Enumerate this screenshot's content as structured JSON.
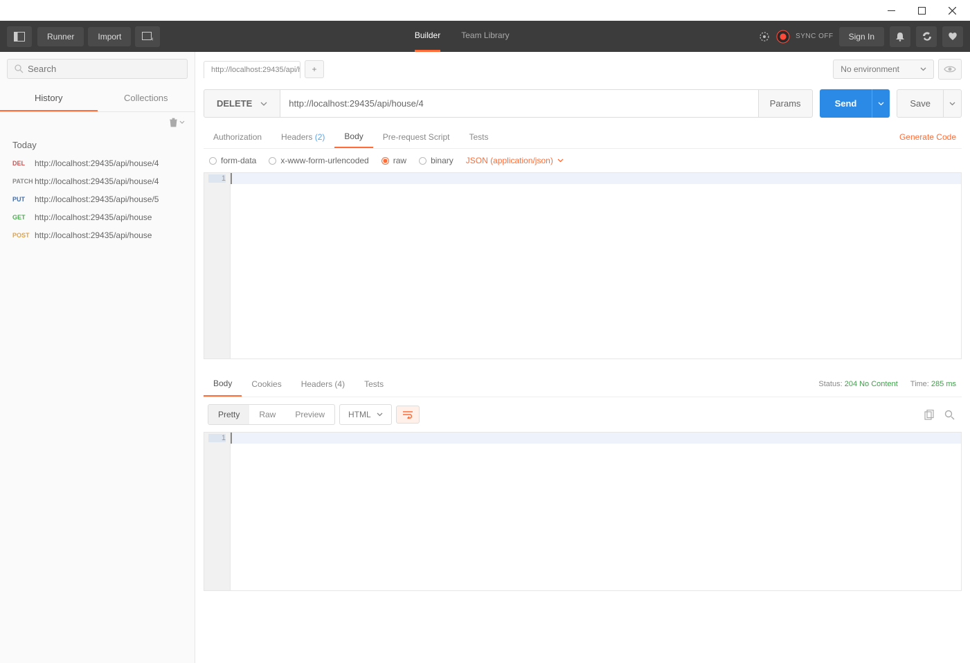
{
  "window": {
    "minimize": "–",
    "maximize": "☐",
    "close": "✕"
  },
  "topbar": {
    "runner": "Runner",
    "import": "Import",
    "tabs": {
      "builder": "Builder",
      "team": "Team Library"
    },
    "sync": "SYNC OFF",
    "signin": "Sign In"
  },
  "sidebar": {
    "search_placeholder": "Search",
    "tabs": {
      "history": "History",
      "collections": "Collections"
    },
    "section": "Today",
    "history": [
      {
        "method": "DEL",
        "mclass": "m-DEL",
        "url": "http://localhost:29435/api/house/4"
      },
      {
        "method": "PATCH",
        "mclass": "m-PATCH",
        "url": "http://localhost:29435/api/house/4"
      },
      {
        "method": "PUT",
        "mclass": "m-PUT",
        "url": "http://localhost:29435/api/house/5"
      },
      {
        "method": "GET",
        "mclass": "m-GET",
        "url": "http://localhost:29435/api/house"
      },
      {
        "method": "POST",
        "mclass": "m-POST",
        "url": "http://localhost:29435/api/house"
      }
    ]
  },
  "tabrow": {
    "tab_label": "http://localhost:29435/api/h",
    "env": "No environment"
  },
  "request": {
    "method": "DELETE",
    "url": "http://localhost:29435/api/house/4",
    "params": "Params",
    "send": "Send",
    "save": "Save",
    "tabs": {
      "auth": "Authorization",
      "headers": "Headers",
      "hcount": "(2)",
      "body": "Body",
      "prescript": "Pre-request Script",
      "tests": "Tests"
    },
    "gencode": "Generate Code",
    "body_opts": {
      "formdata": "form-data",
      "xwww": "x-www-form-urlencoded",
      "raw": "raw",
      "binary": "binary",
      "json": "JSON (application/json)"
    },
    "line": "1"
  },
  "response": {
    "tabs": {
      "body": "Body",
      "cookies": "Cookies",
      "headers": "Headers",
      "hcount": "(4)",
      "tests": "Tests"
    },
    "status_label": "Status:",
    "status_value": "204 No Content",
    "time_label": "Time:",
    "time_value": "285 ms",
    "view": {
      "pretty": "Pretty",
      "raw": "Raw",
      "preview": "Preview",
      "format": "HTML"
    },
    "line": "1"
  }
}
